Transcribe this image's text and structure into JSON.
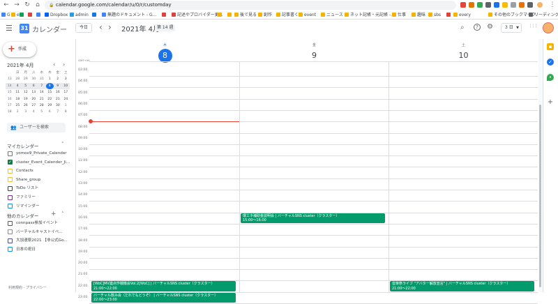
{
  "browser": {
    "url": "calendar.google.com/calendar/u/0/r/customday",
    "bookmarks": [
      {
        "label": "G",
        "color": "#4285f4"
      },
      {
        "label": "e",
        "color": "#f4b400"
      },
      {
        "label": "",
        "color": "#0f9d58"
      },
      {
        "label": "",
        "color": "#db4437"
      },
      {
        "label": "",
        "color": "#4285f4"
      },
      {
        "label": "Dropbox",
        "color": "#0061ff"
      },
      {
        "label": "admin",
        "color": "#2d9cdb"
      },
      {
        "label": "",
        "color": "#1a73e8"
      },
      {
        "label": "無題のドキュメント - G...",
        "color": "#4285f4"
      },
      {
        "label": "",
        "color": "#db4437"
      },
      {
        "label": "記述やプロバイダー更...",
        "color": "#db4437"
      },
      {
        "label": "",
        "color": "#f4b400"
      },
      {
        "label": "",
        "color": "#f4b400"
      },
      {
        "label": "後で見る",
        "color": "#f4b400"
      },
      {
        "label": "創作",
        "color": "#f4b400"
      },
      {
        "label": "記事書く",
        "color": "#f4b400"
      },
      {
        "label": "event",
        "color": "#f4b400"
      },
      {
        "label": "ニュース",
        "color": "#f4b400"
      },
      {
        "label": "ネット記帳・元記帳 -...",
        "color": "#f4b400"
      },
      {
        "label": "仕事",
        "color": "#f4b400"
      },
      {
        "label": "趣味",
        "color": "#f4b400"
      },
      {
        "label": "sbs",
        "color": "#f4b400"
      },
      {
        "label": "",
        "color": "#db4437"
      },
      {
        "label": "every",
        "color": "#f4b400"
      },
      {
        "label": "その他のブックマーク",
        "color": "#f4b400"
      },
      {
        "label": "リーディング リスト",
        "color": "#5f6368"
      }
    ]
  },
  "header": {
    "app_title": "カレンダー",
    "today_label": "今日",
    "date_title": "2021年 4月",
    "week_badge": "第 14 週",
    "view_label": "3 日",
    "icons": {
      "menu": "☰",
      "prev": "‹",
      "next": "›",
      "search": "⌕",
      "help": "?",
      "settings": "⚙",
      "apps": "⋮⋮⋮"
    }
  },
  "sidebar": {
    "create_label": "作成",
    "mini_calendar": {
      "title": "2021年 4月",
      "day_headers": [
        "日",
        "月",
        "火",
        "水",
        "木",
        "金",
        "土"
      ],
      "weeks": [
        {
          "wk": "13",
          "days": [
            "28",
            "29",
            "30",
            "31",
            "1",
            "2",
            "3"
          ],
          "muted": [
            true,
            true,
            true,
            true,
            false,
            false,
            false
          ]
        },
        {
          "wk": "14",
          "days": [
            "4",
            "5",
            "6",
            "7",
            "8",
            "9",
            "10"
          ],
          "muted": [
            false,
            false,
            false,
            false,
            false,
            false,
            false
          ],
          "today_index": 4
        },
        {
          "wk": "15",
          "days": [
            "11",
            "12",
            "13",
            "14",
            "15",
            "16",
            "17"
          ],
          "muted": [
            false,
            false,
            false,
            false,
            false,
            false,
            false
          ]
        },
        {
          "wk": "16",
          "days": [
            "18",
            "19",
            "20",
            "21",
            "22",
            "23",
            "24"
          ],
          "muted": [
            false,
            false,
            false,
            false,
            false,
            false,
            false
          ]
        },
        {
          "wk": "17",
          "days": [
            "25",
            "26",
            "27",
            "28",
            "29",
            "30",
            "1"
          ],
          "muted": [
            false,
            false,
            false,
            false,
            false,
            false,
            true
          ]
        },
        {
          "wk": "18",
          "days": [
            "2",
            "3",
            "4",
            "5",
            "6",
            "7",
            "8"
          ],
          "muted": [
            true,
            true,
            true,
            true,
            true,
            true,
            true
          ]
        }
      ]
    },
    "search_people_label": "ユーザーを検索",
    "my_calendars_title": "マイカレンダー",
    "my_calendars": [
      {
        "label": "yomox9_Private_Calender",
        "color": "#039be5",
        "checked": false
      },
      {
        "label": "cluster_Event_Calender_Ji...",
        "color": "#0b8043",
        "checked": true
      },
      {
        "label": "Contacts",
        "color": "#f6bf26",
        "checked": false
      },
      {
        "label": "Share_group",
        "color": "#f6bf26",
        "checked": false
      },
      {
        "label": "ToDo リスト",
        "color": "#d50000",
        "checked": false
      },
      {
        "label": "ファミリー",
        "color": "#8e24aa",
        "checked": false
      },
      {
        "label": "リマインダー",
        "color": "#039be5",
        "checked": false
      }
    ],
    "other_calendars_title": "他のカレンダー",
    "other_calendars": [
      {
        "label": "connpass参加イベント",
        "color": "#3f51b5",
        "checked": false
      },
      {
        "label": "バーチャルキャストイベ...",
        "color": "#7986cb",
        "checked": false
      },
      {
        "label": "大加速祭2021 【非公式Go...",
        "color": "#3f51b5",
        "checked": false
      },
      {
        "label": "日本の祝日",
        "color": "#039be5",
        "checked": false
      }
    ],
    "footer": "利用規約 - プライバシー"
  },
  "grid": {
    "timezone": "GMT+09",
    "days": [
      {
        "dow": "木",
        "num": "8",
        "today": true
      },
      {
        "dow": "金",
        "num": "9",
        "today": false
      },
      {
        "dow": "土",
        "num": "10",
        "today": false
      }
    ],
    "hours": [
      "03:00",
      "04:00",
      "05:00",
      "06:00",
      "07:00",
      "08:00",
      "09:00",
      "10:00",
      "11:00",
      "12:00",
      "13:00",
      "14:00",
      "15:00",
      "16:00",
      "17:00",
      "18:00",
      "19:00",
      "20:00",
      "21:00",
      "22:00",
      "23:00"
    ],
    "events": [
      {
        "title": "環エネ補助金説明会 | バーチャルSNS cluster（クラスター）",
        "time": "15:00～16:00",
        "day": 1
      },
      {
        "title": "[WoC]MV連点作戦機会Vol.2[WoC] | バーチャルSNS cluster（クラスター）",
        "time": "21:00～22:00",
        "day": 0
      },
      {
        "title": "バーチャル飲み会（だれでもどうぞ） | バーチャルSNS cluster（クラスター）",
        "time": "22:00～23:00",
        "day": 0
      },
      {
        "title": "音楽祭ライブ \"アバター解放宣言\" | バーチャルSNS cluster（クラスター）",
        "time": "21:00～22:00",
        "day": 2
      }
    ],
    "event_color": "#039b6c",
    "now_line_color": "#ea4335"
  }
}
